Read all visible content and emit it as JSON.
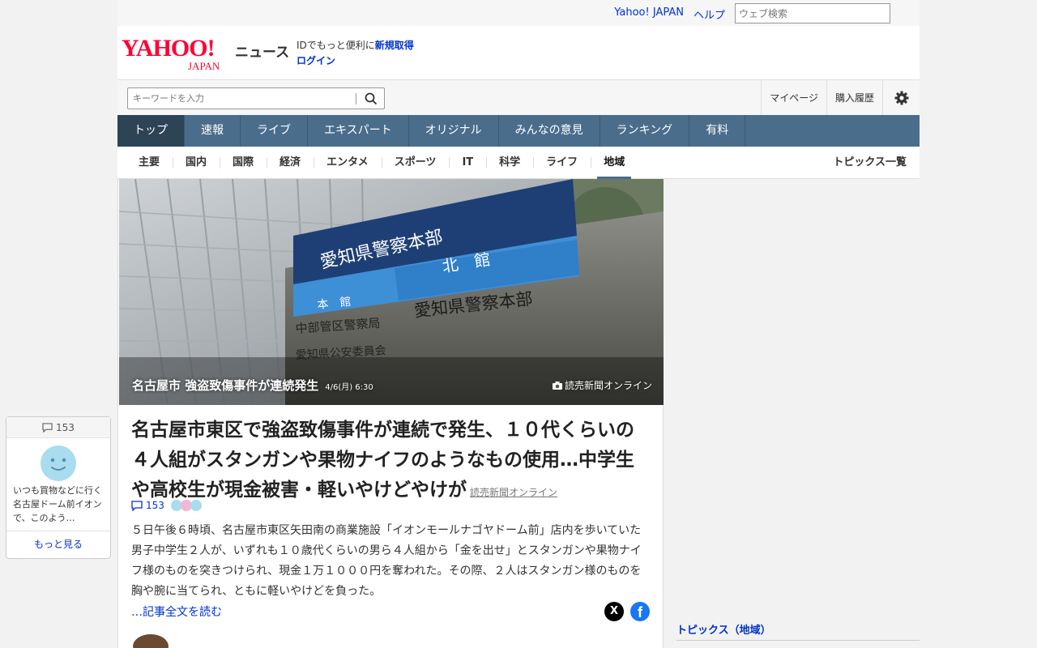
{
  "topbar": {
    "yahoo_link": "Yahoo! JAPAN",
    "help_link": "ヘルプ",
    "web_search_placeholder": "ウェブ検索"
  },
  "header": {
    "logo_yahoo": "YAHOO!",
    "logo_japan": "JAPAN",
    "logo_news": "ニュース",
    "id_text": "IDでもっと便利に",
    "signup": "新規取得",
    "login": "ログイン"
  },
  "search": {
    "placeholder": "キーワードを入力"
  },
  "rightnav": {
    "mypage": "マイページ",
    "purchase_history": "購入履歴"
  },
  "mainnav": [
    "トップ",
    "速報",
    "ライブ",
    "エキスパート",
    "オリジナル",
    "みんなの意見",
    "ランキング",
    "有料"
  ],
  "subnav": {
    "categories": [
      "主要",
      "国内",
      "国際",
      "経済",
      "エンタメ",
      "スポーツ",
      "IT",
      "科学",
      "ライフ",
      "地域"
    ],
    "topics_list": "トピックス一覧"
  },
  "photo": {
    "caption": "名古屋市 強盗致傷事件が連続発生",
    "time": "4/6(月) 6:30",
    "credit": "読売新聞オンライン",
    "sign_main": "愛知県警察本部",
    "sign_north": "北　館",
    "sign_honkan": "本　館",
    "sign_station": "中部管区警察局",
    "sign_committee": "愛知県公安委員会",
    "sign_lower": "愛知県警察本部"
  },
  "article": {
    "headline": "名古屋市東区で強盗致傷事件が連続で発生、１０代くらいの４人組がスタンガンや果物ナイフのようなもの使用…中学生や高校生が現金被害・軽いやけどやけが",
    "source": "読売新聞オンライン",
    "comment_count": "153",
    "body": "５日午後６時頃、名古屋市東区矢田南の商業施設「イオンモールナゴヤドーム前」店内を歩いていた男子中学生２人が、いずれも１０歳代くらいの男ら４人組から「金を出せ」とスタンガンや果物ナイフ様のものを突きつけられ、現金１万１０００円を奪われた。その際、２人はスタンガン様のものを胸や腕に当てられ、ともに軽いやけどを負った。",
    "read_more": "…記事全文を読む",
    "share_x": "X",
    "share_facebook": "f"
  },
  "comment_card": {
    "count": "153",
    "text": "いつも買物などに行く名古屋ドーム前イオンで、このよう…",
    "more": "もっと見る"
  },
  "sidebar": {
    "topics_heading": "トピックス（地域）"
  },
  "colors": {
    "yahoo_red": "#ff0033",
    "nav_blue": "#4a6d8c",
    "link_blue": "#0033cc"
  }
}
